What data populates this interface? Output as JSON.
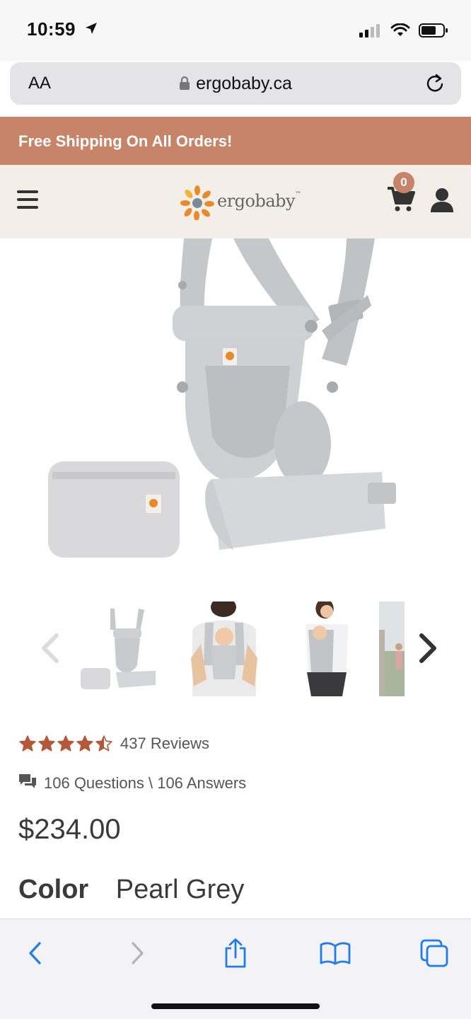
{
  "status_bar": {
    "time": "10:59"
  },
  "browser": {
    "text_size_label": "AA",
    "url": "ergobaby.ca"
  },
  "promo": {
    "text": "Free Shipping On All Orders!"
  },
  "header": {
    "logo_text": "ergobaby",
    "logo_tm": "™",
    "cart_count": "0"
  },
  "product": {
    "rating_value": 4.5,
    "reviews_label": "437 Reviews",
    "qa_label": "106 Questions \\ 106 Answers",
    "price": "$234.00",
    "color_label": "Color",
    "color_value": "Pearl Grey"
  },
  "colors": {
    "accent": "#c88468",
    "star": "#b5583a",
    "header_bg": "#f3efe8",
    "ios_blue": "#1e7cf0"
  },
  "icons": [
    "location-arrow-icon",
    "signal-icon",
    "wifi-icon",
    "battery-icon",
    "lock-icon",
    "reload-icon",
    "hamburger-icon",
    "cart-icon",
    "user-icon",
    "chevron-left-icon",
    "chevron-right-icon",
    "star-icon",
    "chat-icon",
    "back-icon",
    "forward-icon",
    "share-icon",
    "bookmarks-icon",
    "tabs-icon"
  ]
}
